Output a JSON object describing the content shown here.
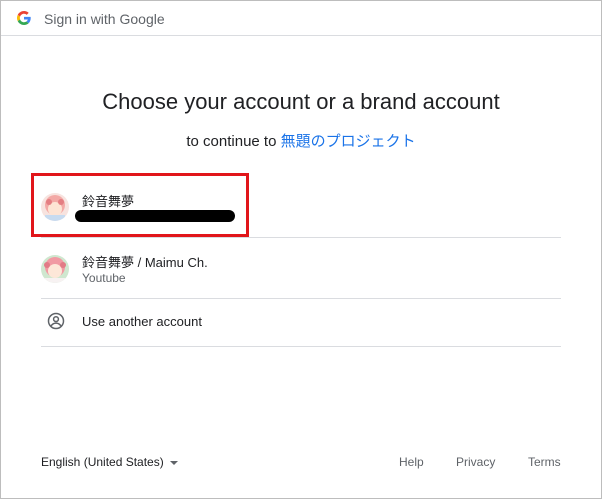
{
  "header": {
    "title": "Sign in with Google",
    "logo_icon": "google-g-icon"
  },
  "main": {
    "heading": "Choose your account or a brand account",
    "subheading_prefix": "to continue to",
    "app_name": "無題のプロジェクト"
  },
  "accounts": [
    {
      "name": "鈴音舞夢",
      "email_redacted": true,
      "highlighted": true
    },
    {
      "name": "鈴音舞夢 / Maimu Ch.",
      "subtitle": "Youtube"
    }
  ],
  "use_another": {
    "label": "Use another account",
    "icon": "person-circle-icon"
  },
  "footer": {
    "language": "English (United States)",
    "help": "Help",
    "privacy": "Privacy",
    "terms": "Terms"
  },
  "colors": {
    "link": "#1a73e8",
    "highlight_box": "#e1151a",
    "divider": "#dadce0"
  }
}
